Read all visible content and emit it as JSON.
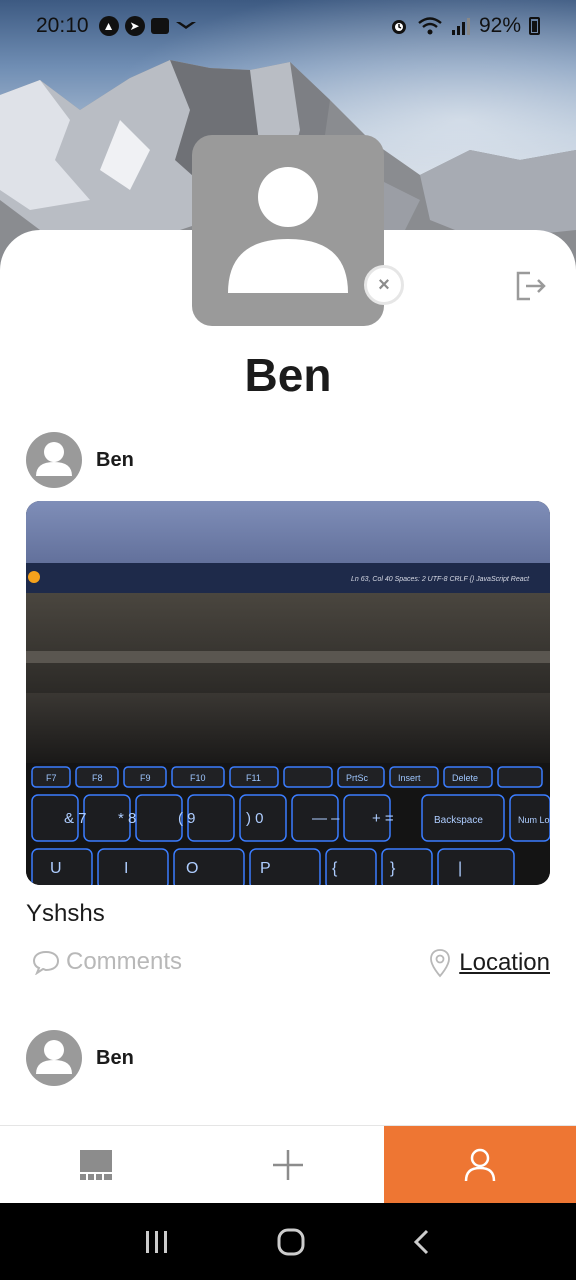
{
  "status_bar": {
    "time": "20:10",
    "battery": "92%"
  },
  "profile": {
    "name": "Ben",
    "remove_icon": "×"
  },
  "posts": [
    {
      "author": "Ben",
      "caption": "Yshshs",
      "comments_label": "Comments",
      "location_label": "Location",
      "image_text": {
        "editor_status": "Ln 63, Col 40   Spaces: 2   UTF-8   CRLF   {} JavaScript React",
        "keys_row1": [
          "F7",
          "F8",
          "F9",
          "F10",
          "F11",
          "PrtSc",
          "Insert",
          "Delete"
        ],
        "keys_row2": [
          "&\n7",
          "*\n8",
          "(\n9",
          ")\n0",
          "—\n–",
          "+\n=",
          "Backspace",
          "Num\nLock"
        ],
        "keys_row3": [
          "U",
          "I",
          "O",
          "P",
          "{",
          "}",
          "|"
        ]
      }
    },
    {
      "author": "Ben"
    }
  ],
  "bottom_nav": {
    "items": [
      {
        "icon": "grid-icon",
        "active": false
      },
      {
        "icon": "plus-icon",
        "active": false
      },
      {
        "icon": "person-icon",
        "active": true
      }
    ],
    "accent": "#ee7633"
  },
  "system_nav": {
    "icons": [
      "recents-icon",
      "home-icon",
      "back-icon"
    ]
  }
}
